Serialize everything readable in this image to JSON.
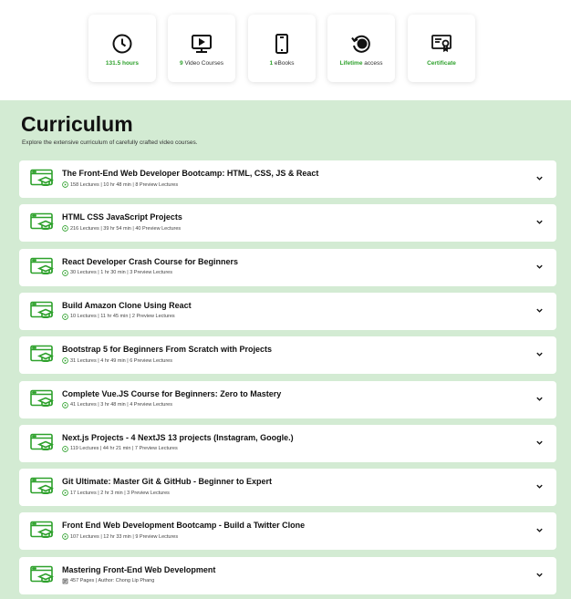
{
  "stats": [
    {
      "icon": "clock-icon",
      "highlight": "131.5 hours",
      "rest": ""
    },
    {
      "icon": "video-icon",
      "highlight": "9",
      "rest": " Video Courses"
    },
    {
      "icon": "phone-icon",
      "highlight": "1",
      "rest": " eBooks"
    },
    {
      "icon": "lifetime-icon",
      "highlight": "Lifetime",
      "rest": " access"
    },
    {
      "icon": "certificate-icon",
      "highlight": "Certificate",
      "rest": ""
    }
  ],
  "curriculum": {
    "title": "Curriculum",
    "subtitle": "Explore the extensive curriculum of carefully crafted video courses."
  },
  "courses": [
    {
      "title": "The Front-End Web Developer Bootcamp: HTML, CSS, JS & React",
      "meta": "158 Lectures | 10 hr 48 min | 8 Preview Lectures",
      "kind": "video"
    },
    {
      "title": "HTML CSS JavaScript Projects",
      "meta": "216 Lectures | 39 hr 54 min | 40 Preview Lectures",
      "kind": "video"
    },
    {
      "title": "React Developer Crash Course for Beginners",
      "meta": "30 Lectures | 1 hr 30 min | 3 Preview Lectures",
      "kind": "video"
    },
    {
      "title": "Build Amazon Clone Using React",
      "meta": "10 Lectures | 11 hr 45 min | 2 Preview Lectures",
      "kind": "video"
    },
    {
      "title": "Bootstrap 5 for Beginners From Scratch with Projects",
      "meta": "31 Lectures | 4 hr 49 min | 6 Preview Lectures",
      "kind": "video"
    },
    {
      "title": "Complete Vue.JS Course for Beginners: Zero to Mastery",
      "meta": "41 Lectures | 3 hr 48 min | 4 Preview Lectures",
      "kind": "video"
    },
    {
      "title": "Next.js Projects - 4 NextJS 13 projects (Instagram, Google.)",
      "meta": "119 Lectures | 44 hr 21 min | 7 Preview Lectures",
      "kind": "video"
    },
    {
      "title": "Git Ultimate: Master Git & GitHub - Beginner to Expert",
      "meta": "17 Lectures | 2 hr 3 min | 3 Preview Lectures",
      "kind": "video"
    },
    {
      "title": "Front End Web Development Bootcamp - Build a Twitter Clone",
      "meta": "107 Lectures | 12 hr 33 min | 9 Preview Lectures",
      "kind": "video"
    },
    {
      "title": "Mastering Front-End Web Development",
      "meta": "457 Pages | Author: Chong Lip Phang",
      "kind": "book"
    }
  ],
  "colors": {
    "accent": "#2ea12c",
    "section_bg": "#d3ebd3",
    "card_bg": "#ffffff"
  }
}
